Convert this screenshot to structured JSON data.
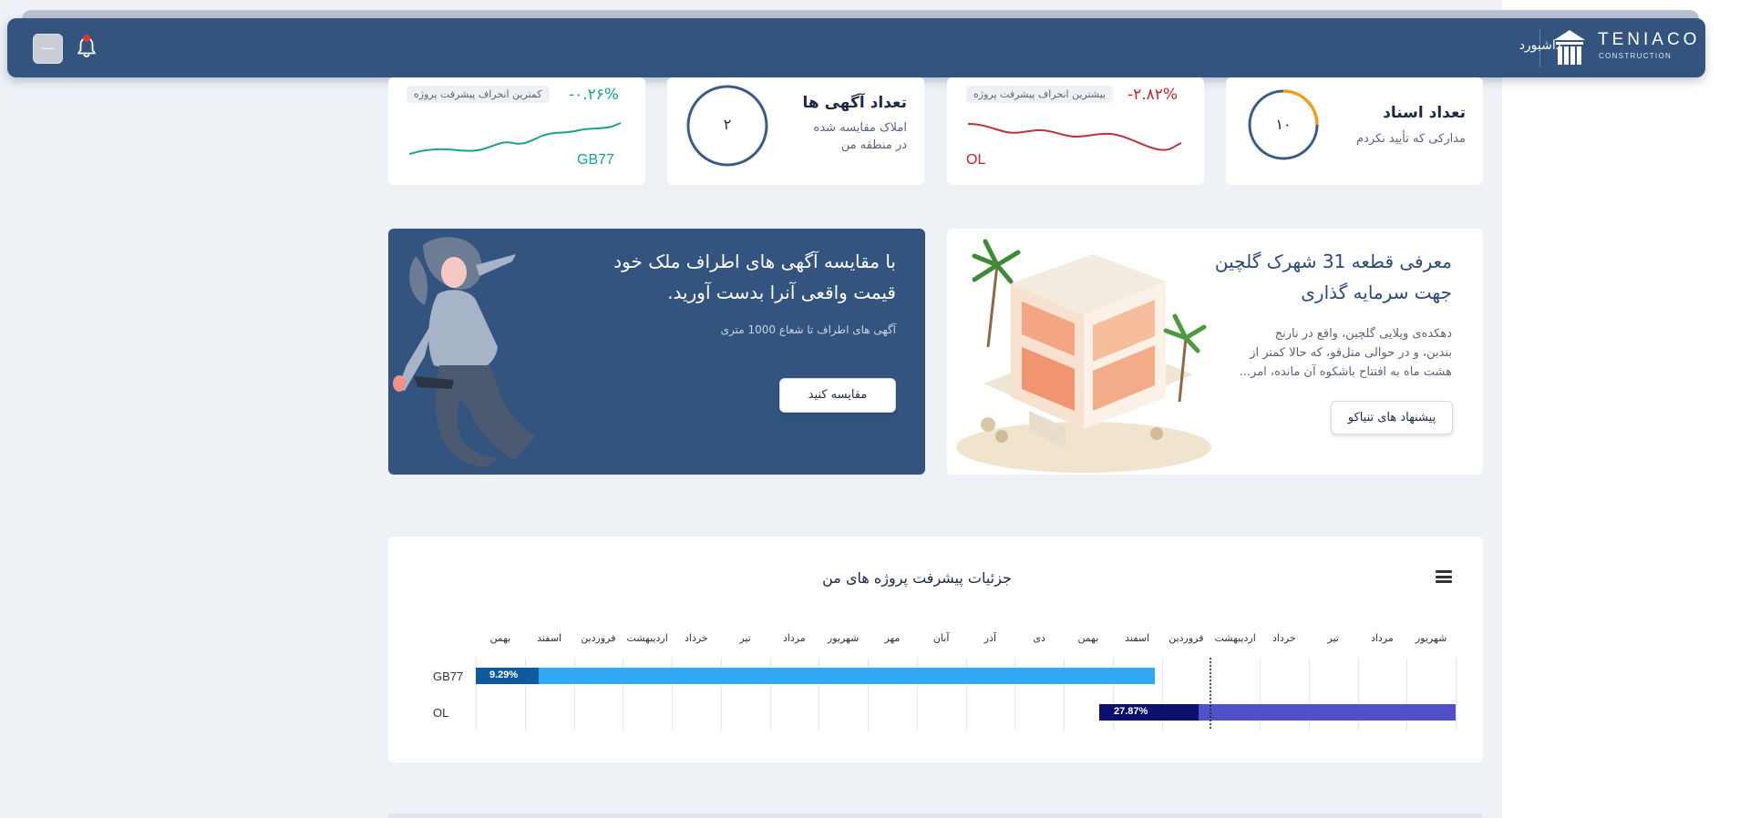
{
  "topbar": {
    "nav_dashboard": "داشبورد",
    "logo_name": "TENIACO",
    "logo_sub": "CONSTRUCTION",
    "menu_button": "—"
  },
  "stats": {
    "documents": {
      "title": "تعداد اسناد",
      "subtitle": "مدارکی که تأیید نکردم",
      "value": "۱۰"
    },
    "max_deviation": {
      "pill": "بیشترین انحراف پیشرفت پروژه",
      "percent": "-۲.۸۲%",
      "code": "OL"
    },
    "ads": {
      "title": "تعداد آگهی ها",
      "subtitle_line1": "املاک مقایسه شده",
      "subtitle_line2": "در منطقه من",
      "value": "۲"
    },
    "min_deviation": {
      "pill": "کمترین انحراف پیشرفت پروژه",
      "percent": "-۰.۲۶%",
      "code": "GB77"
    }
  },
  "promo_project": {
    "title_line1": "معرفی قطعه 31 شهرک گلچین",
    "title_line2": "جهت سرمایه گذاری",
    "text_line1": "دهکده‌ی ویلایی گلچین، واقع در نارنج",
    "text_line2": "بندبن، و در حوالی متل‌قو، که حالا کمتر از",
    "text_line3": "هشت ماه به افتتاح باشکوه آن مانده، امر...",
    "button": "پیشنهاد های تنیاکو"
  },
  "promo_compare": {
    "title_line1": "با مقایسه آگهی های اطراف ملک خود",
    "title_line2": "قیمت واقعی آنرا بدست آورید.",
    "subtitle": "آگهی های اطراف تا شعاع 1000 متری",
    "button": "مقایسه کنید"
  },
  "gantt": {
    "title": "جزئیات پیشرفت پروژه های من",
    "months": [
      "شهریور",
      "مرداد",
      "تیر",
      "خرداد",
      "اردیبهشت",
      "فروردین",
      "اسفند",
      "بهمن",
      "دی",
      "آذر",
      "آبان",
      "مهر",
      "شهریور",
      "مرداد",
      "تیر",
      "خرداد",
      "اردیبهشت",
      "فروردین",
      "اسفند",
      "بهمن"
    ],
    "rows": [
      {
        "label": "GB77",
        "progress_label": "9.29%",
        "progress": 0.0929
      },
      {
        "label": "OL",
        "progress_label": "27.87%",
        "progress": 0.2787
      }
    ]
  },
  "colors": {
    "navy": "#33547f",
    "gb77_bar": "#2fa8f5",
    "gb77_progress": "#0e5a9e",
    "ol_bar": "#5050c8",
    "ol_progress": "#0c0f6b",
    "positive_green": "#1aa38a",
    "negative_red": "#c0262d"
  }
}
